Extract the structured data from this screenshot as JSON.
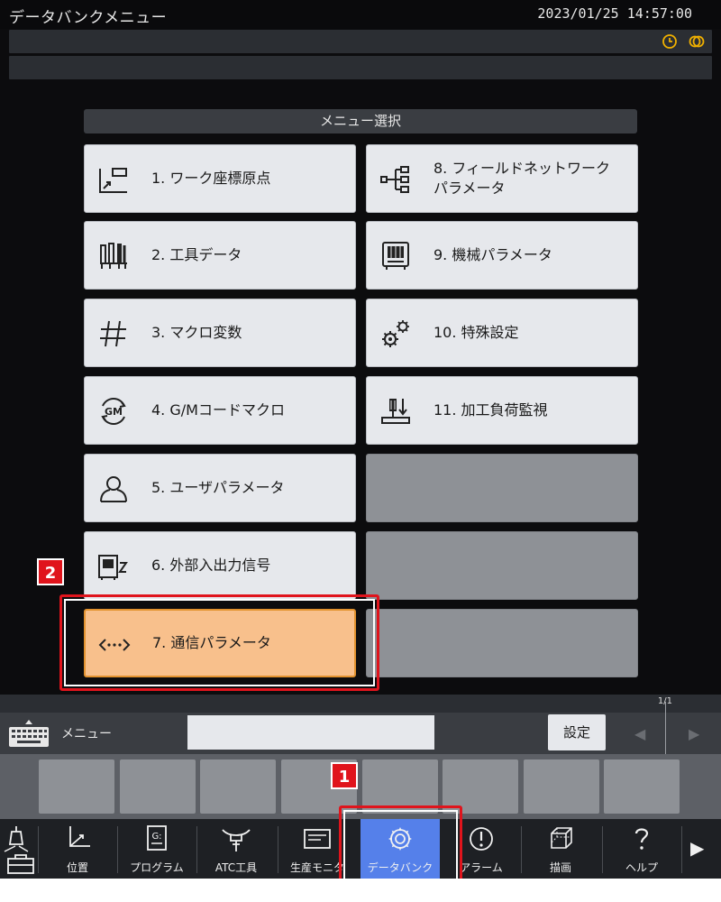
{
  "window": {
    "title": "データバンクメニュー",
    "datetime": "2023/01/25 14:57:00"
  },
  "status_icons": [
    "clock-icon",
    "link-icon"
  ],
  "menu": {
    "header": "メニュー選択",
    "tiles": [
      {
        "label": "1. ワーク座標原点",
        "icon": "work-coordinate-icon",
        "state": "normal"
      },
      {
        "label": "2. 工具データ",
        "icon": "tool-data-icon",
        "state": "normal"
      },
      {
        "label": "3. マクロ変数",
        "icon": "hash-icon",
        "state": "normal"
      },
      {
        "label": "4. G/Mコードマクロ",
        "icon": "gm-code-icon",
        "state": "normal"
      },
      {
        "label": "5. ユーザパラメータ",
        "icon": "user-icon",
        "state": "normal"
      },
      {
        "label": "6. 外部入出力信号",
        "icon": "external-io-icon",
        "state": "normal"
      },
      {
        "label": "7. 通信パラメータ",
        "icon": "communication-icon",
        "state": "selected"
      },
      {
        "label": "8. フィールドネットワークパラメータ",
        "icon": "network-tree-icon",
        "state": "normal"
      },
      {
        "label": "9. 機械パラメータ",
        "icon": "machine-icon",
        "state": "normal"
      },
      {
        "label": "10. 特殊設定",
        "icon": "gears-icon",
        "state": "normal"
      },
      {
        "label": "11. 加工負荷監視",
        "icon": "load-monitor-icon",
        "state": "normal"
      }
    ]
  },
  "callouts": {
    "one": "1",
    "two": "2"
  },
  "input": {
    "menu_label": "メニュー",
    "value": "",
    "set_button": "設定",
    "page_indicator": "1/1",
    "prev_arrow": "◀",
    "next_arrow": "▶"
  },
  "nav": {
    "items": [
      {
        "label": "位置",
        "icon": "axes-icon"
      },
      {
        "label": "プログラム",
        "icon": "program-icon"
      },
      {
        "label": "ATC工具",
        "icon": "atc-tool-icon"
      },
      {
        "label": "生産モニタ",
        "icon": "monitor-icon"
      },
      {
        "label": "データバンク",
        "icon": "gear-icon",
        "active": true
      },
      {
        "label": "アラーム",
        "icon": "alarm-icon"
      },
      {
        "label": "描画",
        "icon": "cube-icon"
      },
      {
        "label": "ヘルプ",
        "icon": "help-icon"
      }
    ],
    "more_arrow": "▶"
  },
  "colors": {
    "accent": "#5580ea",
    "selected_tile": "#f8c08c",
    "callout_red": "#e0141c",
    "status_icon": "#f0b000"
  }
}
